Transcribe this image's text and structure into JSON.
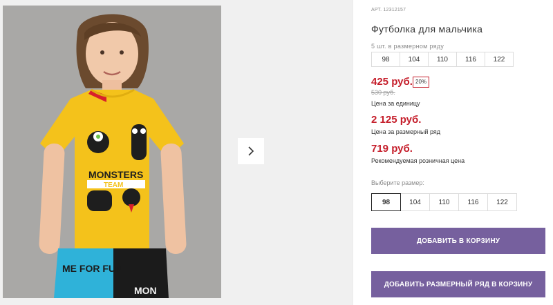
{
  "product": {
    "article": "АРТ. 12312157",
    "title": "Футболка для мальчика",
    "row_label": "5 шт. в размерном ряду",
    "row_sizes": [
      "98",
      "104",
      "110",
      "116",
      "122"
    ]
  },
  "pricing": {
    "unit_price": "425 руб.",
    "discount": "20%",
    "old_price": "530 руб.",
    "unit_caption": "Цена за единицу",
    "row_price": "2 125 руб.",
    "row_caption": "Цена за размерный ряд",
    "retail_price": "719 руб.",
    "retail_caption": "Рекомендуемая розничная цена"
  },
  "size_picker": {
    "label": "Выберите размер:",
    "options": [
      "98",
      "104",
      "110",
      "116",
      "122"
    ],
    "selected": "98"
  },
  "actions": {
    "add_to_cart": "ДОБАВИТЬ В КОРЗИНУ",
    "add_row_to_cart": "ДОБАВИТЬ РАЗМЕРНЫЙ РЯД В КОРЗИНУ"
  },
  "image": {
    "shirt_print_line1": "MONSTERS",
    "shirt_print_line2": "TEAM",
    "shorts_print": "ME FOR FUN",
    "shorts_print_right": "MON"
  },
  "colors": {
    "accent": "#76609e",
    "price_red": "#c51d2a",
    "shirt_yellow": "#f4c21b"
  },
  "icons": {
    "gallery_next": "chevron-right-icon"
  }
}
